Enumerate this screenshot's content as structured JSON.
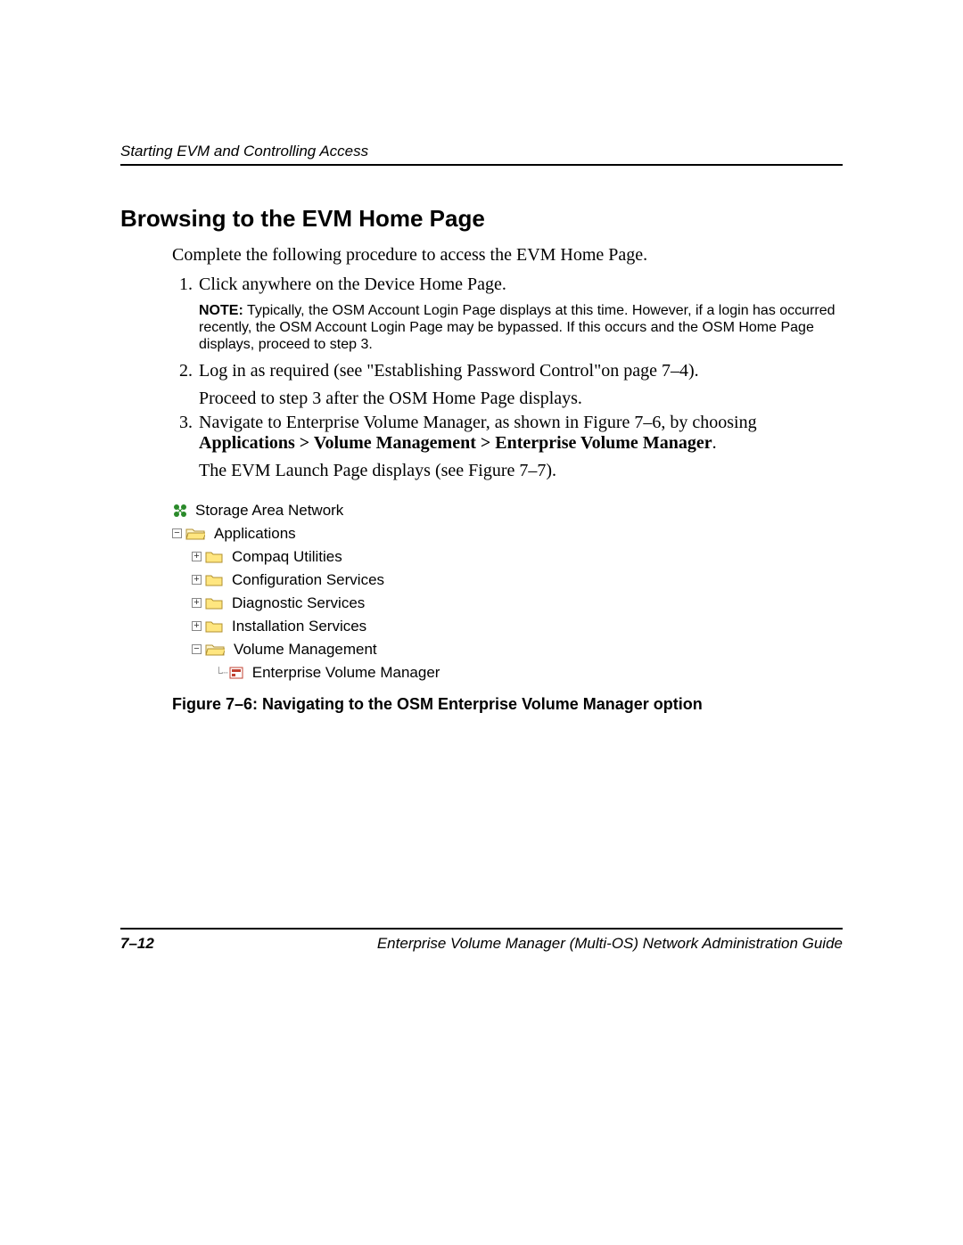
{
  "header": {
    "running": "Starting EVM and Controlling Access"
  },
  "title": "Browsing to the EVM Home Page",
  "intro": "Complete the following procedure to access the EVM Home Page.",
  "steps": {
    "s1": "Click anywhere on the Device Home Page.",
    "note_label": "NOTE:",
    "note_body": "  Typically, the OSM Account Login Page displays at this time. However, if a login has occurred recently, the OSM Account Login Page may be bypassed. If this occurs and the OSM Home Page displays, proceed to step 3.",
    "s2": "Log in as required (see \"Establishing Password Control\"on page 7–4).",
    "s2_sub": "Proceed to step 3 after the OSM Home Page displays.",
    "s3_a": "Navigate to Enterprise Volume Manager, as shown in Figure 7–6, by choosing ",
    "s3_b": "Applications > Volume Management > Enterprise Volume Manager",
    "s3_c": ".",
    "s3_sub": "The EVM Launch Page displays (see Figure 7–7)."
  },
  "tree": {
    "root": "Storage Area Network",
    "l1": "Applications",
    "l2a": "Compaq Utilities",
    "l2b": "Configuration Services",
    "l2c": "Diagnostic Services",
    "l2d": "Installation Services",
    "l2e": "Volume Management",
    "l3": "Enterprise Volume Manager"
  },
  "figure_caption": "Figure 7–6:  Navigating to the OSM Enterprise Volume Manager option",
  "footer": {
    "page": "7–12",
    "doc": "Enterprise Volume Manager (Multi-OS) Network Administration Guide"
  }
}
